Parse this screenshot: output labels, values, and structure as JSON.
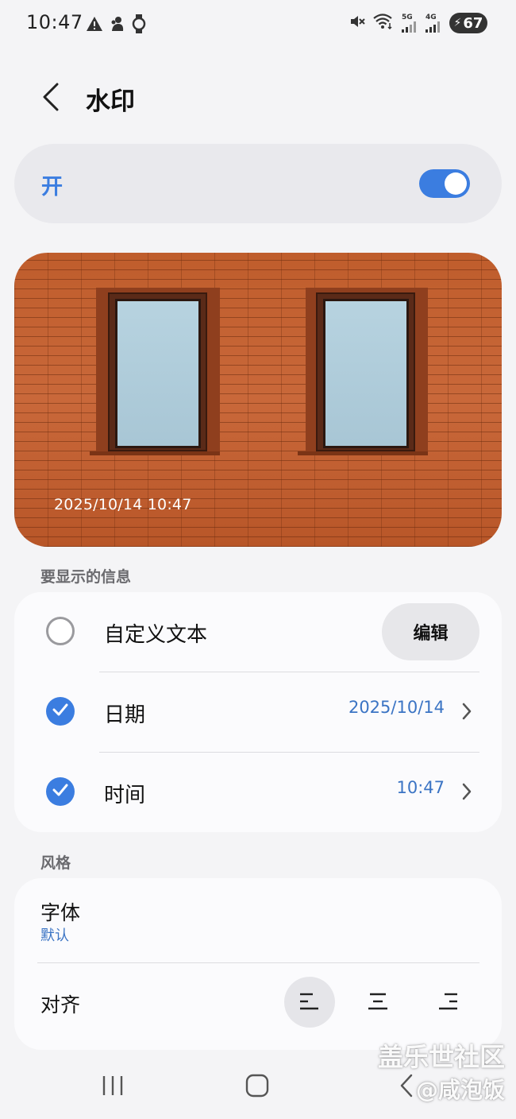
{
  "status_bar": {
    "time": "10:47",
    "left_icons": [
      "warning-icon",
      "app-notification-icon",
      "watch-icon"
    ],
    "network_1": "5G",
    "network_2": "4G",
    "battery": "67"
  },
  "header": {
    "title": "水印"
  },
  "master_switch": {
    "label": "开",
    "on": true,
    "accent": "#3b7de0"
  },
  "preview": {
    "watermark_text": "2025/10/14 10:47"
  },
  "info_section": {
    "label": "要显示的信息",
    "custom_text": {
      "label": "自定义文本",
      "checked": false,
      "edit_label": "编辑"
    },
    "date": {
      "label": "日期",
      "checked": true,
      "value": "2025/10/14"
    },
    "time": {
      "label": "时间",
      "checked": true,
      "value": "10:47"
    }
  },
  "style_section": {
    "label": "风格",
    "font": {
      "label": "字体",
      "value": "默认"
    },
    "align": {
      "label": "对齐",
      "options": [
        "left",
        "center",
        "right"
      ],
      "selected": "left"
    }
  },
  "overlay": {
    "line1": "盖乐世社区",
    "line2": "@咸泡饭"
  }
}
